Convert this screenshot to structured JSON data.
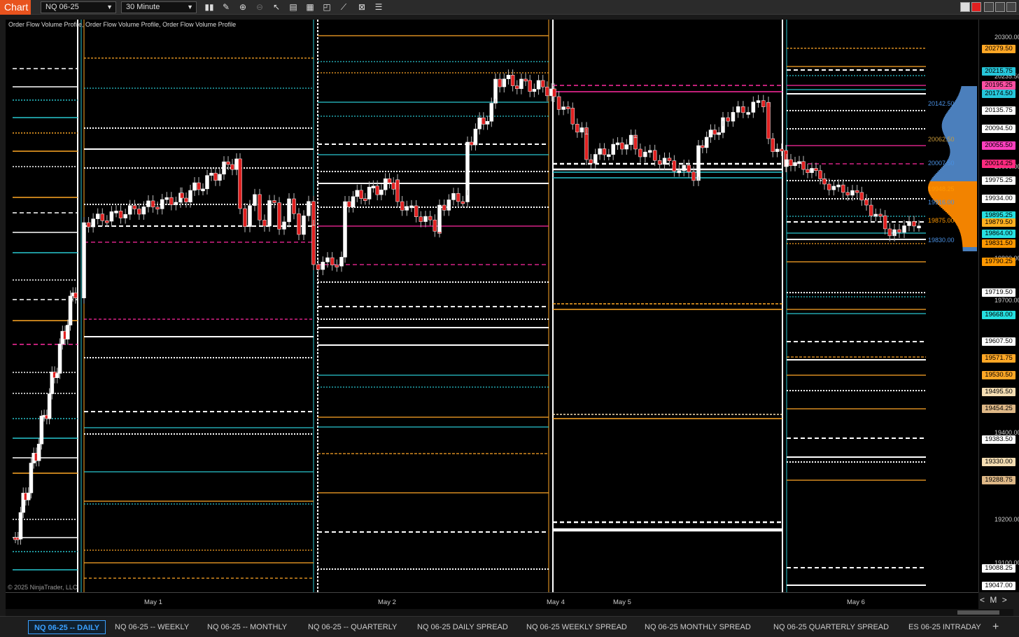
{
  "window": {
    "chart_label": "Chart",
    "instrument": "NQ 06-25",
    "interval": "30 Minute"
  },
  "toolbar_icons": [
    "bar-type-icon",
    "draw-icon",
    "zoom-in-icon",
    "zoom-out-icon",
    "pointer-icon",
    "data-box-icon",
    "properties-icon",
    "strategies-icon",
    "indicators-icon",
    "templates-icon",
    "list-icon"
  ],
  "indicator_title": "Order Flow Volume Profile, Order Flow Volume Profile, Order Flow Volume Profile",
  "copyright": "© 2025 NinjaTrader, LLC",
  "y_ticks": [
    "20300.00",
    "20235.50",
    "20000.00",
    "19800.00",
    "19700.00",
    "19400.00",
    "19200.00",
    "19100.00"
  ],
  "price_badges": [
    {
      "text": "20279.50",
      "color": "#ffa726"
    },
    {
      "text": "20215.75",
      "color": "#26c6da"
    },
    {
      "text": "20195.25",
      "color": "#ff4fa3"
    },
    {
      "text": "20174.50",
      "color": "#26c6da"
    },
    {
      "text": "20135.75",
      "color": "#ffffff"
    },
    {
      "text": "20094.50",
      "color": "#ffffff"
    },
    {
      "text": "20055.50",
      "color": "#ff3fbf"
    },
    {
      "text": "20014.25",
      "color": "#ff2a7f"
    },
    {
      "text": "19975.25",
      "color": "#ffffff"
    },
    {
      "text": "19934.00",
      "color": "#ffffff"
    },
    {
      "text": "19895.25",
      "color": "#26e0e0"
    },
    {
      "text": "19879.50",
      "color": "#ffb020"
    },
    {
      "text": "19864.00",
      "color": "#26e0e0"
    },
    {
      "text": "19831.50",
      "color": "#ff9800"
    },
    {
      "text": "19790.25",
      "color": "#ff9800"
    },
    {
      "text": "19719.50",
      "color": "#ffffff"
    },
    {
      "text": "19668.00",
      "color": "#26e0e0"
    },
    {
      "text": "19607.50",
      "color": "#ffffff"
    },
    {
      "text": "19571.75",
      "color": "#ffa726"
    },
    {
      "text": "19530.50",
      "color": "#ffa726"
    },
    {
      "text": "19495.50",
      "color": "#f5deb3"
    },
    {
      "text": "19454.25",
      "color": "#deb887"
    },
    {
      "text": "19383.50",
      "color": "#ffffff"
    },
    {
      "text": "19330.00",
      "color": "#f5deb3"
    },
    {
      "text": "19288.75",
      "color": "#deb887"
    },
    {
      "text": "19088.25",
      "color": "#ffffff"
    },
    {
      "text": "19047.00",
      "color": "#ffffff"
    }
  ],
  "profile_labels": [
    {
      "text": "20142.50",
      "color": "#4a90e2"
    },
    {
      "text": "20062.50",
      "color": "#c99a3a"
    },
    {
      "text": "20007.50",
      "color": "#4a90e2"
    },
    {
      "text": "19948.25",
      "color": "#ff9800"
    },
    {
      "text": "19916.00",
      "color": "#4a90e2"
    },
    {
      "text": "19875.00",
      "color": "#ff9800"
    },
    {
      "text": "19830.00",
      "color": "#4a90e2"
    }
  ],
  "x_labels": [
    "May 1",
    "May 2",
    "May 4",
    "May 5",
    "May 6"
  ],
  "zoom_control": {
    "left": "<",
    "mid": "M",
    "right": ">"
  },
  "tabs": [
    {
      "label": "NQ 06-25 -- DAILY",
      "active": true
    },
    {
      "label": "NQ 06-25 -- WEEKLY"
    },
    {
      "label": "NQ 06-25 -- MONTHLY"
    },
    {
      "label": "NQ 06-25 -- QUARTERLY"
    },
    {
      "label": "NQ 06-25 DAILY SPREAD"
    },
    {
      "label": "NQ 06-25 WEEKLY SPREAD"
    },
    {
      "label": "NQ 06-25 MONTHLY SPREAD"
    },
    {
      "label": "NQ 06-25 QUARTERLY SPREAD"
    },
    {
      "label": "ES 06-25 INTRADAY"
    }
  ],
  "add_tab": "+"
}
